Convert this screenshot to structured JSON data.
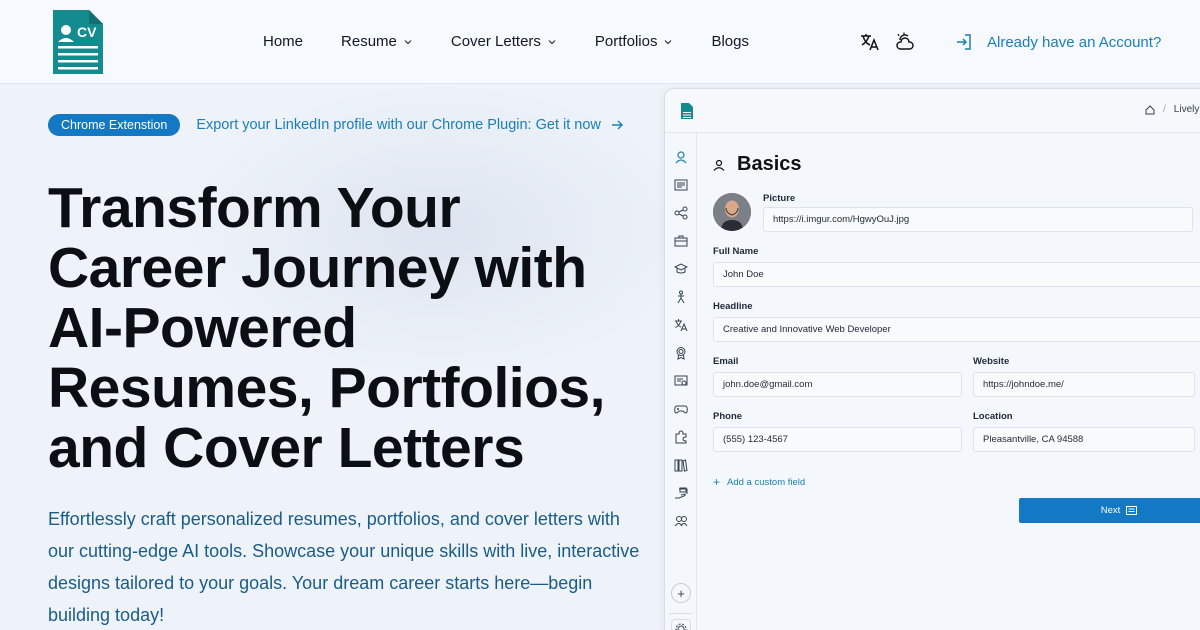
{
  "header": {
    "logo_text": "CV",
    "nav": [
      {
        "label": "Home",
        "has_dropdown": false
      },
      {
        "label": "Resume",
        "has_dropdown": true
      },
      {
        "label": "Cover Letters",
        "has_dropdown": true
      },
      {
        "label": "Portfolios",
        "has_dropdown": true
      },
      {
        "label": "Blogs",
        "has_dropdown": false
      }
    ],
    "translate_icon": "translate-icon",
    "theme_icon": "weather-cloud-icon",
    "login_label": "Already have an Account?",
    "login_icon": "login-icon"
  },
  "hero": {
    "badge_label": "Chrome Extenstion",
    "badge_link": "Export your LinkedIn profile with our Chrome Plugin: Get it now",
    "title_lines": [
      "Transform Your",
      "Career Journey with",
      "AI-Powered",
      "Resumes, Portfolios,",
      "and Cover Letters"
    ],
    "description": "Effortlessly craft personalized resumes, portfolios, and cover letters with our cutting-edge AI tools. Showcase your unique skills with live, interactive designs tailored to your goals. Your dream career starts here—begin building today!"
  },
  "preview": {
    "breadcrumb": [
      "Lively"
    ],
    "section_title": "Basics",
    "picture_label": "Picture",
    "picture_value": "https://i.imgur.com/HgwyOuJ.jpg",
    "full_name_label": "Full Name",
    "full_name_value": "John Doe",
    "headline_label": "Headline",
    "headline_value": "Creative and Innovative Web Developer",
    "email_label": "Email",
    "email_value": "john.doe@gmail.com",
    "website_label": "Website",
    "website_value": "https://johndoe.me/",
    "phone_label": "Phone",
    "phone_value": "(555) 123-4567",
    "location_label": "Location",
    "location_value": "Pleasantville, CA 94588",
    "add_field_label": "Add a custom field",
    "next_label": "Next",
    "sidebar_icons": [
      "user-icon",
      "summary-icon",
      "network-icon",
      "briefcase-icon",
      "education-icon",
      "skills-icon",
      "languages-icon",
      "awards-icon",
      "certificate-icon",
      "gamepad-icon",
      "puzzle-icon",
      "books-icon",
      "volunteer-icon",
      "references-icon"
    ]
  },
  "colors": {
    "accent": "#1479c4",
    "link": "#1a7fb5",
    "description": "#1b5c86",
    "logo": "#138b8f"
  }
}
